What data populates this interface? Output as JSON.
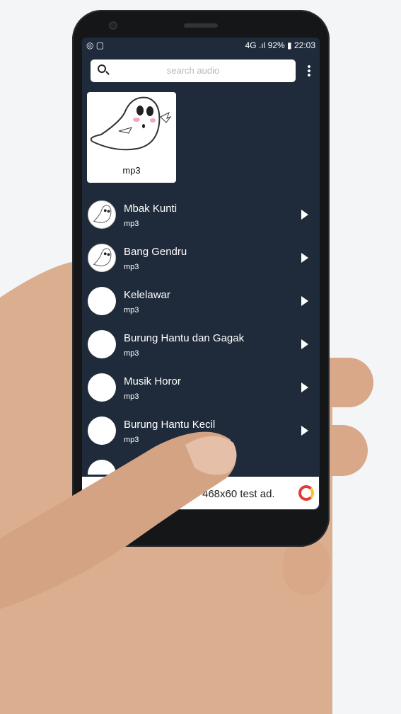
{
  "status": {
    "time": "22:03",
    "battery": "92%",
    "network": "4G"
  },
  "search": {
    "placeholder": "search audio"
  },
  "featured": {
    "label": "mp3"
  },
  "items": [
    {
      "title": "Mbak Kunti",
      "sub": "mp3",
      "avatar": "ghost"
    },
    {
      "title": "Bang Gendru",
      "sub": "mp3",
      "avatar": "ghost"
    },
    {
      "title": "Kelelawar",
      "sub": "mp3",
      "avatar": "blank"
    },
    {
      "title": "Burung Hantu dan Gagak",
      "sub": "mp3",
      "avatar": "blank"
    },
    {
      "title": "Musik Horor",
      "sub": "mp3",
      "avatar": "blank"
    },
    {
      "title": "Burung Hantu Kecil",
      "sub": "mp3",
      "avatar": "blank"
    }
  ],
  "ad": {
    "text": "468x60 test ad."
  },
  "colors": {
    "screen_bg": "#1f2b3b"
  }
}
